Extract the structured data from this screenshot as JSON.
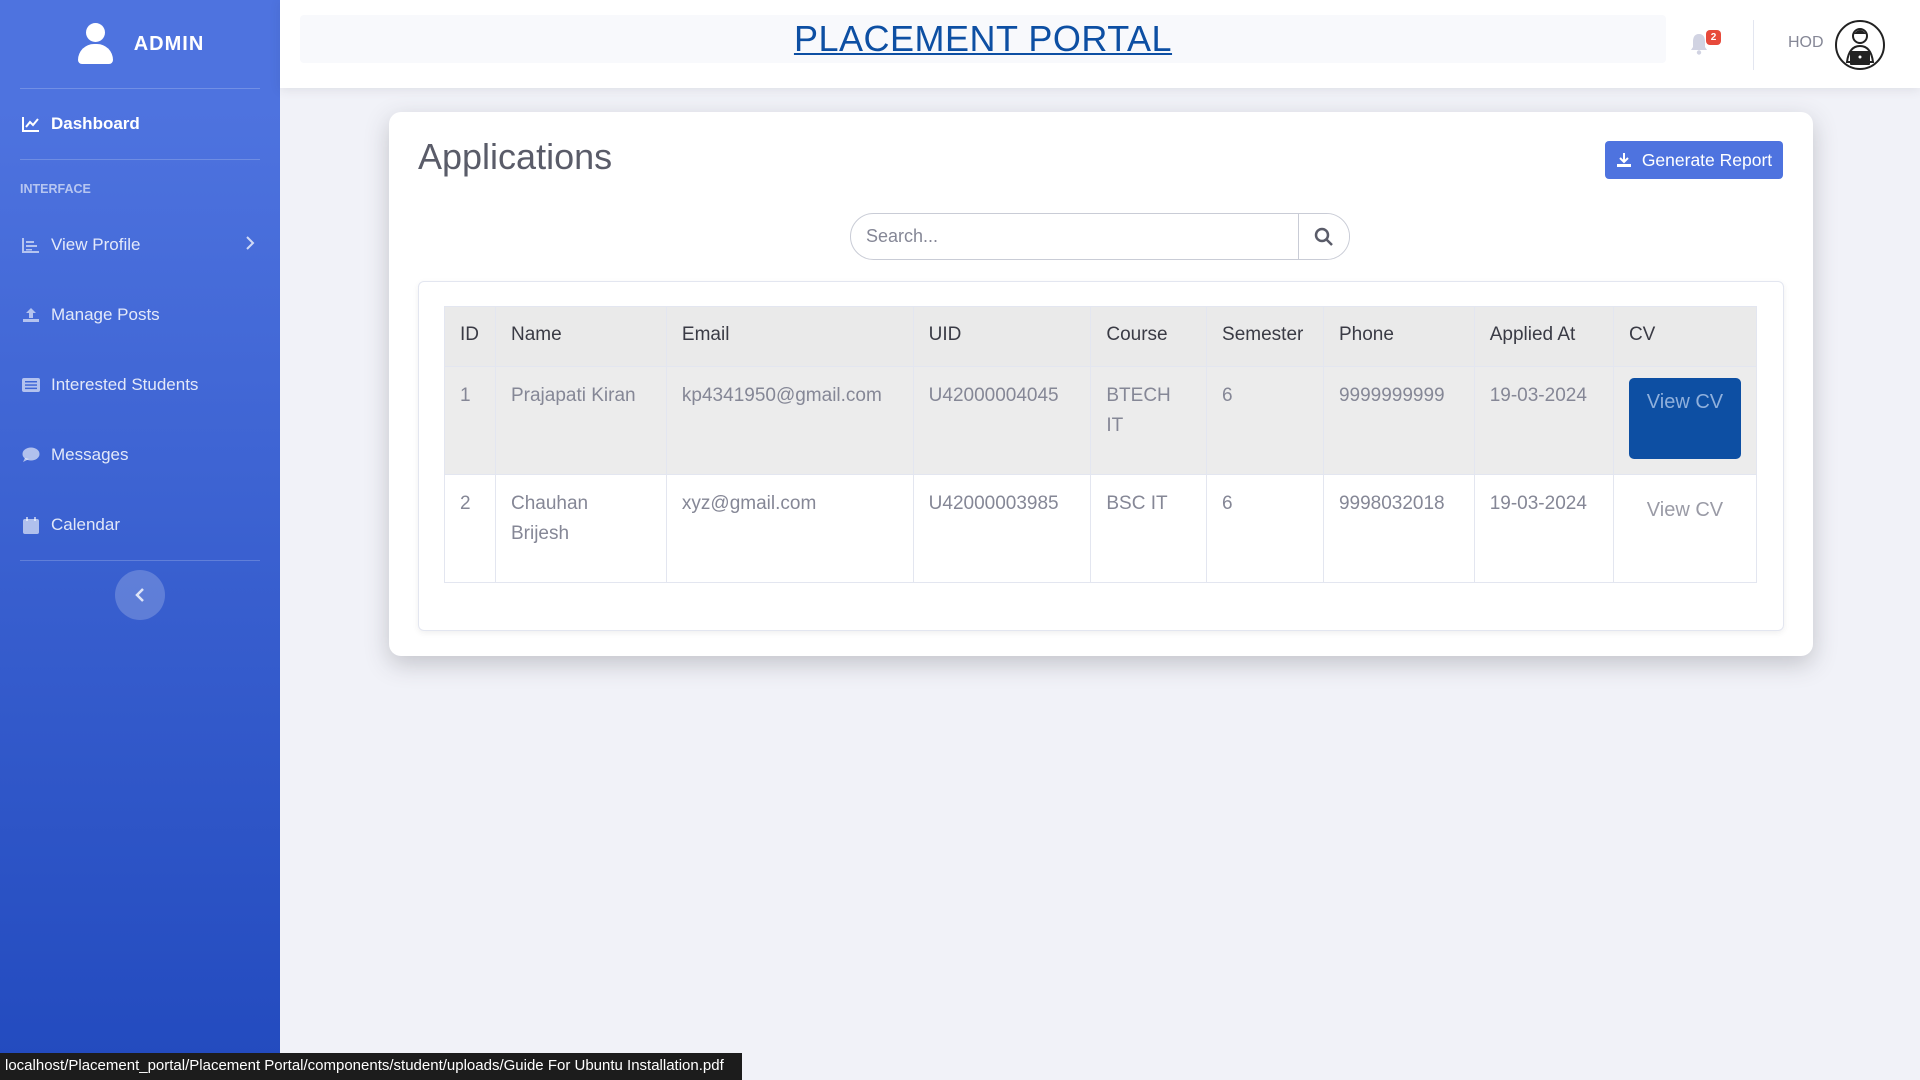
{
  "sidebar": {
    "brand": "ADMIN",
    "dashboard": "Dashboard",
    "section_heading": "INTERFACE",
    "items": [
      {
        "label": "View Profile",
        "icon": "chart-icon"
      },
      {
        "label": "Manage Posts",
        "icon": "upload-icon"
      },
      {
        "label": "Interested Students",
        "icon": "list-icon"
      },
      {
        "label": "Messages",
        "icon": "comment-icon"
      },
      {
        "label": "Calendar",
        "icon": "calendar-icon"
      }
    ]
  },
  "topbar": {
    "title": "PLACEMENT PORTAL",
    "notification_count": "2",
    "user_name": "HOD"
  },
  "main": {
    "title": "Applications",
    "generate_report": "Generate Report",
    "search_placeholder": "Search...",
    "columns": [
      "ID",
      "Name",
      "Email",
      "UID",
      "Course",
      "Semester",
      "Phone",
      "Applied At",
      "CV"
    ],
    "rows": [
      {
        "id": "1",
        "name": "Prajapati Kiran",
        "email": "kp4341950@gmail.com",
        "uid": "U42000004045",
        "course": "BTECH IT",
        "semester": "6",
        "phone": "9999999999",
        "applied_at": "19-03-2024",
        "cv": "View CV"
      },
      {
        "id": "2",
        "name": "Chauhan Brijesh",
        "email": "xyz@gmail.com",
        "uid": "U42000003985",
        "course": "BSC IT",
        "semester": "6",
        "phone": "9998032018",
        "applied_at": "19-03-2024",
        "cv": "View CV"
      }
    ]
  },
  "status_bar": {
    "url": "localhost/Placement_portal/Placement Portal/components/student/uploads/Guide For Ubuntu Installation.pdf"
  },
  "colors": {
    "sidebar_top": "#4e73df",
    "sidebar_bottom": "#224abe",
    "title_blue": "#0d4fa3",
    "primary": "#4e73df",
    "badge": "#e74a3b"
  }
}
